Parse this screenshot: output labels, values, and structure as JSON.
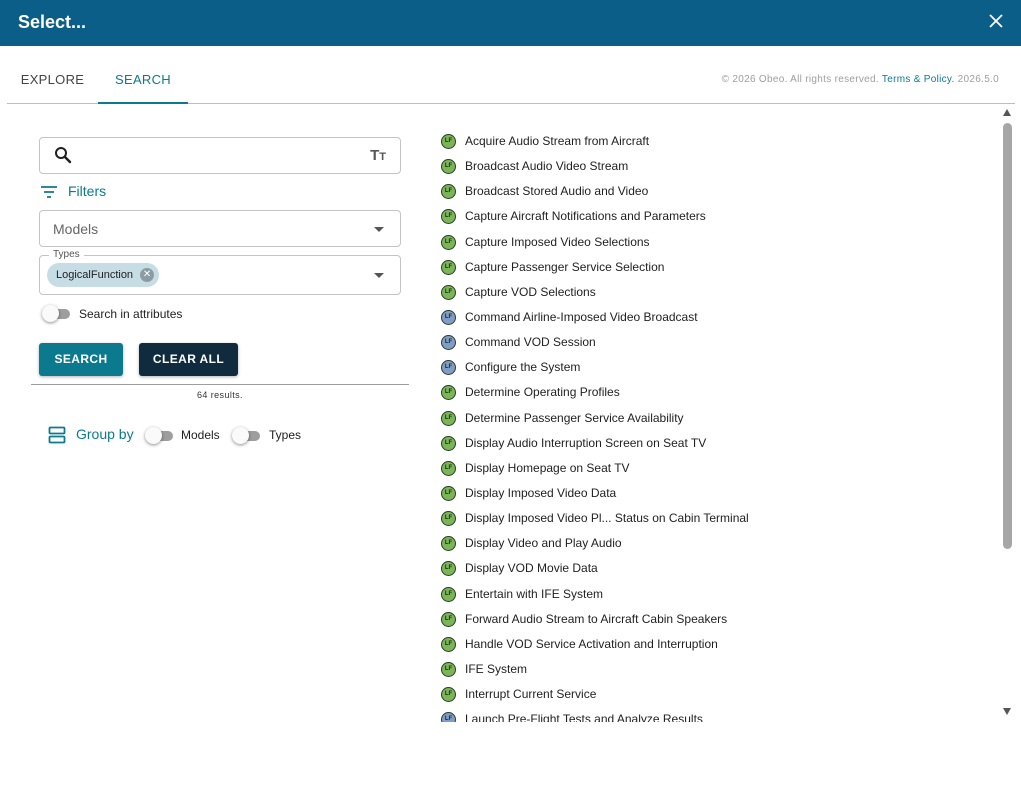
{
  "dialog": {
    "title": "Select...",
    "close_icon": "close-icon",
    "header_color": "#0b5e88"
  },
  "tabs": [
    {
      "label": "EXPLORE",
      "active": false
    },
    {
      "label": "SEARCH",
      "active": true
    }
  ],
  "footer": {
    "copyright": "© 2026 Obeo. All rights reserved.",
    "terms_link": "Terms & Policy.",
    "version": "2026.5.0"
  },
  "search": {
    "value": "",
    "search_icon": "search-icon",
    "match_case_icon": "text-size-icon",
    "filters_label": "Filters",
    "models_placeholder": "Models",
    "types_legend": "Types",
    "types_chip": "LogicalFunction",
    "attributes_toggle_label": "Search in attributes",
    "attributes_toggle_on": false,
    "search_button": "SEARCH",
    "clear_button": "CLEAR ALL",
    "results_text": "64 results.",
    "accent_color": "#0b7a8e"
  },
  "group_by": {
    "label": "Group by",
    "models_label": "Models",
    "models_on": false,
    "types_label": "Types",
    "types_on": false
  },
  "results": [
    {
      "label": "Acquire Audio Stream from Aircraft",
      "icon": "LF",
      "color": "green"
    },
    {
      "label": "Broadcast Audio Video Stream",
      "icon": "LF",
      "color": "green"
    },
    {
      "label": "Broadcast Stored Audio and Video",
      "icon": "LF",
      "color": "green"
    },
    {
      "label": "Capture Aircraft Notifications and Parameters",
      "icon": "LF",
      "color": "green"
    },
    {
      "label": "Capture Imposed Video Selections",
      "icon": "LF",
      "color": "green"
    },
    {
      "label": "Capture Passenger Service Selection",
      "icon": "LF",
      "color": "green"
    },
    {
      "label": "Capture VOD Selections",
      "icon": "LF",
      "color": "green"
    },
    {
      "label": "Command Airline-Imposed Video Broadcast",
      "icon": "LF",
      "color": "blue"
    },
    {
      "label": "Command VOD Session",
      "icon": "LF",
      "color": "blue"
    },
    {
      "label": "Configure the System",
      "icon": "LF",
      "color": "blue"
    },
    {
      "label": "Determine Operating Profiles",
      "icon": "LF",
      "color": "green"
    },
    {
      "label": "Determine Passenger Service Availability",
      "icon": "LF",
      "color": "green"
    },
    {
      "label": "Display Audio Interruption Screen on Seat TV",
      "icon": "LF",
      "color": "green"
    },
    {
      "label": "Display Homepage on Seat TV",
      "icon": "LF",
      "color": "green"
    },
    {
      "label": "Display Imposed Video Data",
      "icon": "LF",
      "color": "green"
    },
    {
      "label": "Display Imposed Video Pl... Status on Cabin Terminal",
      "icon": "LF",
      "color": "green"
    },
    {
      "label": "Display Video and Play Audio",
      "icon": "LF",
      "color": "green"
    },
    {
      "label": "Display VOD Movie Data",
      "icon": "LF",
      "color": "green"
    },
    {
      "label": "Entertain with IFE System",
      "icon": "LF",
      "color": "green"
    },
    {
      "label": "Forward Audio Stream to Aircraft Cabin Speakers",
      "icon": "LF",
      "color": "green"
    },
    {
      "label": "Handle VOD Service Activation and Interruption",
      "icon": "LF",
      "color": "green"
    },
    {
      "label": "IFE System",
      "icon": "LF",
      "color": "green"
    },
    {
      "label": "Interrupt Current Service",
      "icon": "LF",
      "color": "green"
    },
    {
      "label": "Launch Pre-Flight Tests and Analyze Results",
      "icon": "LF",
      "color": "blue"
    }
  ]
}
